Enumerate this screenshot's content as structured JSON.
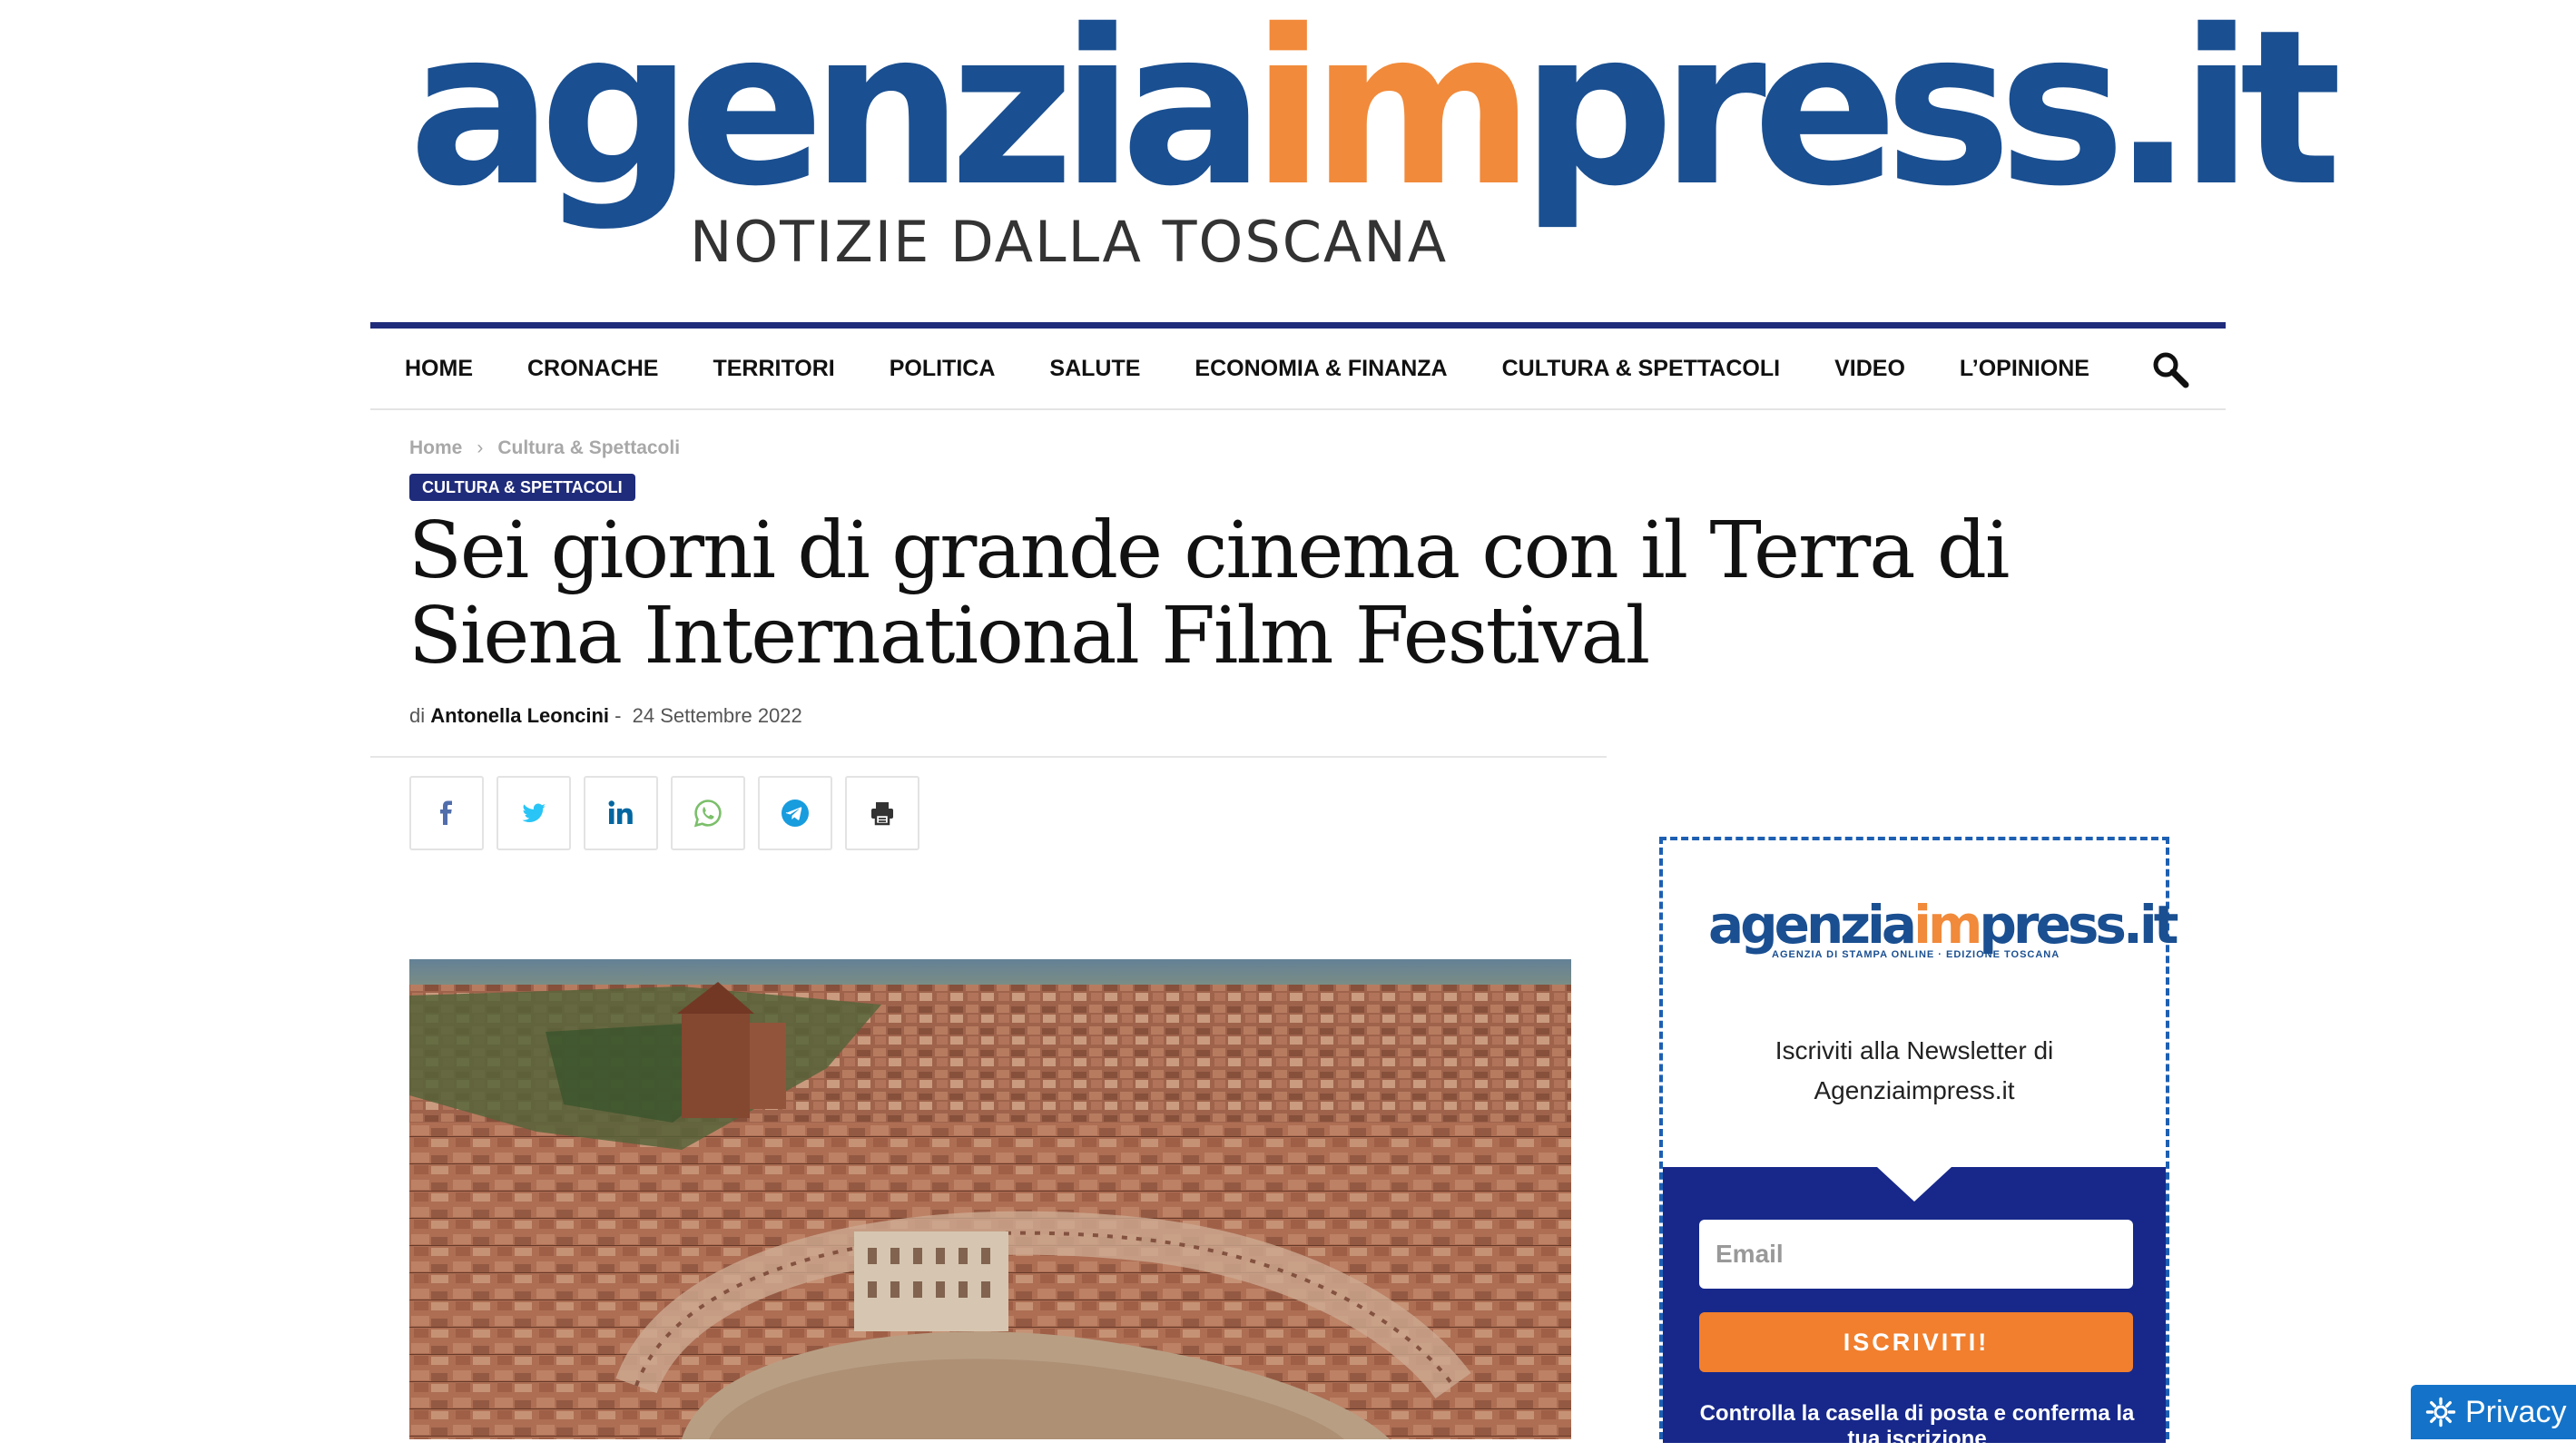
{
  "logo": {
    "word_start": "agenzia",
    "word_accent": "im",
    "word_end": "press.it",
    "tagline": "NOTIZIE DALLA TOSCANA"
  },
  "nav": {
    "items": [
      {
        "label": "HOME"
      },
      {
        "label": "CRONACHE"
      },
      {
        "label": "TERRITORI"
      },
      {
        "label": "POLITICA"
      },
      {
        "label": "SALUTE"
      },
      {
        "label": "ECONOMIA & FINANZA"
      },
      {
        "label": "CULTURA & SPETTACOLI"
      },
      {
        "label": "VIDEO"
      },
      {
        "label": "L’OPINIONE"
      }
    ],
    "search_icon": "search-icon"
  },
  "breadcrumb": {
    "home": "Home",
    "separator": "›",
    "current": "Cultura & Spettacoli"
  },
  "article": {
    "category": "CULTURA & SPETTACOLI",
    "title": "Sei giorni di grande cinema con il Terra di Siena International Film Festival",
    "by_prefix": "di",
    "author": "Antonella Leoncini",
    "dash": "-",
    "date": "24 Settembre 2022"
  },
  "share": [
    {
      "name": "facebook-icon",
      "color": "#516eab"
    },
    {
      "name": "twitter-icon",
      "color": "#29c5f6"
    },
    {
      "name": "linkedin-icon",
      "color": "#0266a0"
    },
    {
      "name": "whatsapp-icon",
      "color": "#7bbf6a"
    },
    {
      "name": "telegram-icon",
      "color": "#179cde"
    },
    {
      "name": "print-icon",
      "color": "#333333"
    }
  ],
  "newsletter": {
    "logo_start": "agenzia",
    "logo_accent": "im",
    "logo_end": "press.it",
    "logo_sub": "AGENZIA DI STAMPA ONLINE · EDIZIONE TOSCANA",
    "intro_line1": "Iscriviti alla Newsletter di",
    "intro_line2": "Agenziaimpress.it",
    "email_placeholder": "Email",
    "submit_label": "ISCRIVITI!",
    "note": "Controlla la casella di posta e conferma la tua iscrizione"
  },
  "privacy": {
    "label": "Privacy"
  },
  "colors": {
    "brand_blue": "#1a4f91",
    "brand_orange": "#f18a3a",
    "nav_border": "#1f2c7b",
    "newsletter_blue": "#17288a",
    "button_orange": "#f17f2e",
    "privacy_blue": "#1473c9"
  }
}
